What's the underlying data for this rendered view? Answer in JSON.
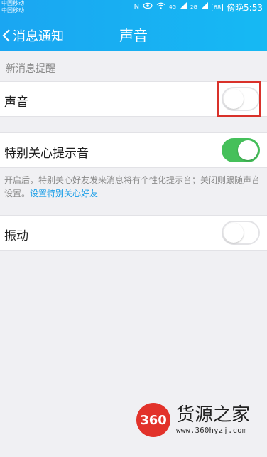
{
  "status_bar": {
    "carrier1": "中国移动",
    "carrier2": "中国移动",
    "icons_left_text": "N",
    "signal1": "4G",
    "signal2": "2G",
    "battery": "68",
    "time": "傍晚5:53"
  },
  "nav": {
    "back_label": "消息通知",
    "title": "声音"
  },
  "section": {
    "header": "新消息提醒"
  },
  "settings": {
    "sound": {
      "label": "声音",
      "enabled": false
    },
    "special_care": {
      "label": "特别关心提示音",
      "enabled": true
    },
    "description": "开启后，特别关心好友发来消息将有个性化提示音；关闭则跟随声音设置。",
    "description_link": "设置特别关心好友",
    "vibration": {
      "label": "振动",
      "enabled": false
    }
  },
  "watermark": {
    "badge": "360",
    "name": "货源之家",
    "url": "www.360hyzj.com"
  },
  "colors": {
    "header_bg": "#1aa6f2",
    "toggle_on": "#45c05a",
    "highlight": "#d9312a",
    "link": "#1a9ee8"
  }
}
